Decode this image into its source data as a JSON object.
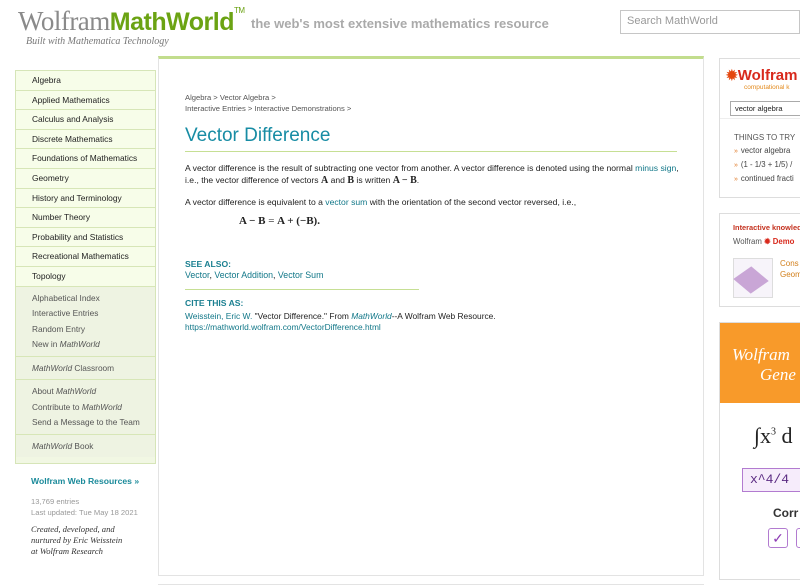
{
  "header": {
    "logo_wolfram": "Wolfram",
    "logo_mathworld": "MathWorld",
    "logo_tm": "TM",
    "logo_sub": "Built with Mathematica Technology",
    "tagline": "the web's most extensive mathematics resource",
    "search_placeholder": "Search MathWorld"
  },
  "nav": {
    "topics": [
      "Algebra",
      "Applied Mathematics",
      "Calculus and Analysis",
      "Discrete Mathematics",
      "Foundations of Mathematics",
      "Geometry",
      "History and Terminology",
      "Number Theory",
      "Probability and Statistics",
      "Recreational Mathematics",
      "Topology"
    ],
    "group1": [
      "Alphabetical Index",
      "Interactive Entries",
      "Random Entry"
    ],
    "new_in_prefix": "New in ",
    "mathworld": "MathWorld",
    "classroom_suffix": " Classroom",
    "about_prefix": "About ",
    "contribute_prefix": "Contribute to ",
    "send_message": "Send a Message to the Team",
    "book_suffix": " Book"
  },
  "sidebar_footer": {
    "web_resources": "Wolfram Web Resources »",
    "entries": "13,769 entries",
    "last_updated": "Last updated: Tue May 18 2021",
    "credit_1": "Created, developed, and",
    "credit_2": "nurtured by Eric Weisstein",
    "credit_3": "at Wolfram Research"
  },
  "main": {
    "breadcrumb": {
      "line1": [
        "Algebra",
        "Vector Algebra"
      ],
      "line2": [
        "Interactive Entries",
        "Interactive Demonstrations"
      ],
      "sep": " > "
    },
    "title": "Vector Difference",
    "p1_a": "A vector difference is the result of subtracting one vector from another. A vector difference is denoted using the normal",
    "p1_link": "minus sign",
    "p1_b": ", i.e., the vector difference of vectors ",
    "p1_A": "A",
    "p1_and": " and ",
    "p1_B": "B",
    "p1_c": " is written ",
    "p1_expr": "A − B",
    "p1_dot": ".",
    "p2_a": "A vector difference is equivalent to a ",
    "p2_link": "vector sum",
    "p2_b": " with the orientation of the second vector reversed, i.e.,",
    "equation_lhs": "A − B",
    "equation_eq": " = ",
    "equation_rhs": "A + (−B).",
    "see_also_label": "SEE ALSO:",
    "see_also": [
      "Vector",
      "Vector Addition",
      "Vector Sum"
    ],
    "see_sep": ", ",
    "cite_label": "CITE THIS AS:",
    "cite_author": "Weisstein, Eric W.",
    "cite_mid": " \"Vector Difference.\" From ",
    "cite_mw": "MathWorld",
    "cite_end": "--A Wolfram Web Resource.",
    "cite_url": "https://mathworld.wolfram.com/VectorDifference.html"
  },
  "right": {
    "wa_logo": "Wolfram",
    "wa_sub": "computational k",
    "wa_query": "vector algebra",
    "try_head": "THINGS TO TRY",
    "try_items": [
      "vector algebra",
      "(1 - 1/3 + 1/5) /",
      "continued fracti"
    ],
    "ik_head": "Interactive knowled",
    "ik_wolfram": "Wolfram ",
    "ik_demo": "Demo",
    "ik_link_1": "Cons",
    "ik_link_2": "Geom",
    "gen_t1": "Wolfram",
    "gen_t2": "Gene",
    "gen_integral": "∫x",
    "gen_power": "3",
    "gen_d": " d",
    "gen_answer": "x^4/4",
    "gen_correct": "Corr",
    "gen_check": "✓"
  },
  "colors": {
    "accent_teal": "#178ca4",
    "brand_green": "#6ba313",
    "wolfram_red": "#d8291c",
    "orange": "#f89a2a"
  }
}
